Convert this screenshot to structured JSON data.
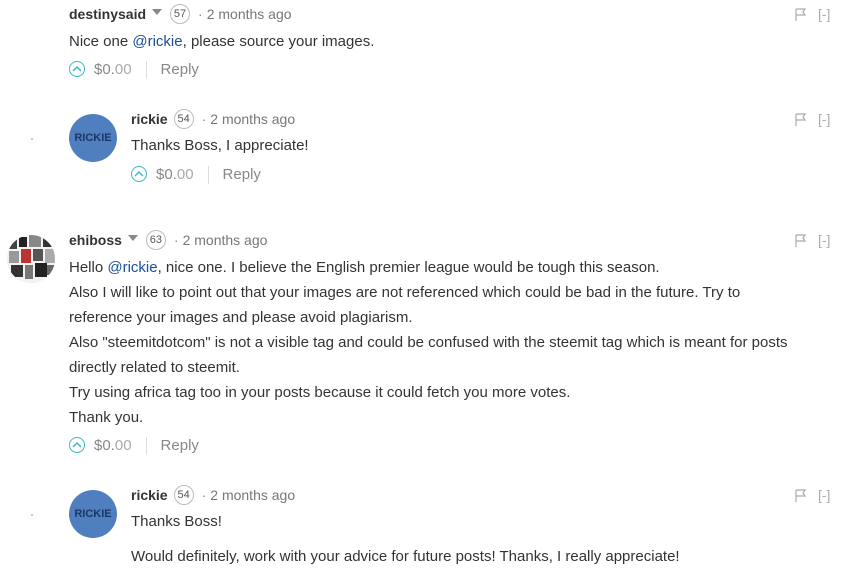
{
  "comments": [
    {
      "author": "destinysaid",
      "reputation": "57",
      "separator": "·",
      "time": "2 months ago",
      "body_prefix": "Nice one ",
      "mention": "@rickie",
      "body_suffix": ", please source your images.",
      "payout_main": "$0.",
      "payout_cents": "00",
      "reply_label": "Reply",
      "collapse_label": "[-]"
    },
    {
      "author": "rickie",
      "reputation": "54",
      "separator": "·",
      "time": "2 months ago",
      "avatar_text": "RICKIE",
      "body": "Thanks Boss, I appreciate!",
      "payout_main": "$0.",
      "payout_cents": "00",
      "reply_label": "Reply",
      "collapse_label": "[-]"
    },
    {
      "author": "ehiboss",
      "reputation": "63",
      "separator": "·",
      "time": "2 months ago",
      "line1_prefix": "Hello ",
      "mention": "@rickie",
      "line1_suffix": ", nice one. I believe the English premier league would be tough this season.",
      "lines": [
        "Also I will like to point out that your images are not referenced which could be bad in the future. Try to",
        "reference your images and please avoid plagiarism.",
        "Also \"steemitdotcom\" is not a visible tag and could be confused with the steemit tag which is meant for posts",
        "directly related to steemit.",
        "Try using africa tag too in your posts because it could fetch you more votes.",
        "Thank you."
      ],
      "payout_main": "$0.",
      "payout_cents": "00",
      "reply_label": "Reply",
      "collapse_label": "[-]"
    },
    {
      "author": "rickie",
      "reputation": "54",
      "separator": "·",
      "time": "2 months ago",
      "avatar_text": "RICKIE",
      "body_line1": "Thanks Boss!",
      "body_line2": "Would definitely, work with your advice for future posts! Thanks, I really appreciate!",
      "collapse_label": "[-]"
    }
  ],
  "colors": {
    "mention": "#1a5099",
    "upvote": "#3ab7c7",
    "avatar": "#4f7fbf"
  },
  "icons": {
    "upvote": "chevron-up-circle-icon",
    "flag": "flag-icon",
    "caret": "caret-down-icon"
  }
}
